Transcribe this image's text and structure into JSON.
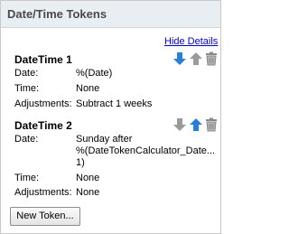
{
  "panel": {
    "title": "Date/Time Tokens",
    "hide_details_link": "Hide Details"
  },
  "tokens": [
    {
      "title": "DateTime 1",
      "date_label": "Date:",
      "date_value": "%(Date)",
      "time_label": "Time:",
      "time_value": "None",
      "adjust_label": "Adjustments:",
      "adjust_value": "Subtract 1 weeks",
      "icons": [
        "arrow-down-icon",
        "arrow-up-icon",
        "trash-icon"
      ]
    },
    {
      "title": "DateTime 2",
      "date_label": "Date:",
      "date_value_lines": [
        "Sunday after",
        "%(DateTokenCalculator_Date...",
        "1)"
      ],
      "time_label": "Time:",
      "time_value": "None",
      "adjust_label": "Adjustments:",
      "adjust_value": "None",
      "icons": [
        "arrow-down-icon",
        "arrow-up-icon",
        "trash-icon"
      ]
    }
  ],
  "buttons": {
    "new_token": "New Token..."
  },
  "colors": {
    "header_bg": "#e9eef3",
    "active_arrow": "#2a7fd4",
    "disabled_icon": "#9a9a9a",
    "link": "#0000cc"
  }
}
